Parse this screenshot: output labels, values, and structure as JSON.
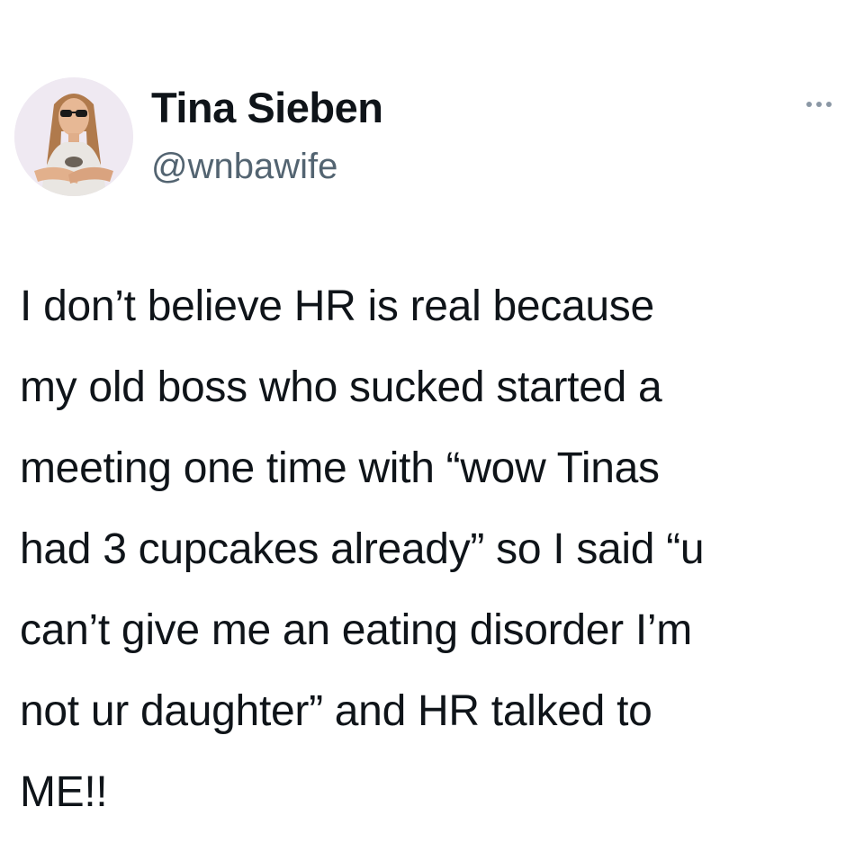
{
  "author": {
    "display_name": "Tina Sieben",
    "handle": "@wnbawife",
    "avatar_icon": "profile-photo"
  },
  "menu": {
    "more_icon": "ellipsis-horizontal-icon"
  },
  "tweet": {
    "lines": [
      "I don’t believe HR is real because",
      "my old boss who sucked started a",
      "meeting one time with “wow Tinas",
      "had 3 cupcakes already” so I said “u",
      "can’t give me an eating disorder I’m",
      "not ur daughter” and HR talked to",
      "ME!!"
    ]
  },
  "colors": {
    "text_primary": "#0f1419",
    "text_secondary": "#536471",
    "icon_gray": "#8b98a5",
    "background": "#ffffff"
  }
}
